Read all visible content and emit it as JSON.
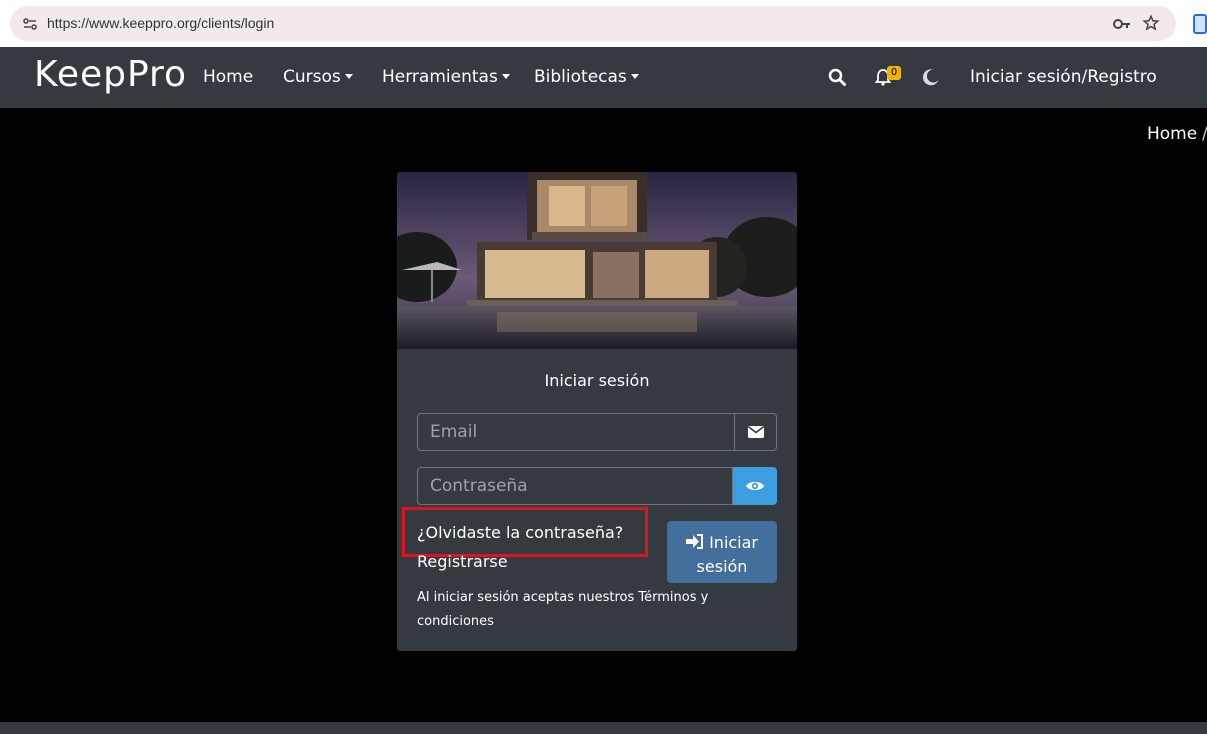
{
  "browser": {
    "url": "https://www.keeppro.org/clients/login"
  },
  "navbar": {
    "logo": "KeepPro",
    "links": [
      "Home",
      "Cursos",
      "Herramientas",
      "Bibliotecas"
    ],
    "notification_count": "0",
    "login_register": "Iniciar sesión/Registro"
  },
  "breadcrumb": {
    "home": "Home",
    "separator": "/"
  },
  "login_card": {
    "title": "Iniciar sesión",
    "email_placeholder": "Email",
    "password_placeholder": "Contraseña",
    "forgot_password": "¿Olvidaste la contraseña?",
    "register": "Registrarse",
    "login_button_line1": "Iniciar",
    "login_button_line2": "sesión",
    "terms": "Al iniciar sesión aceptas nuestros Términos y condiciones"
  },
  "colors": {
    "navbar_bg": "#343a40",
    "card_bg": "#343a40",
    "eye_button": "#3a9ee0",
    "login_button": "#446f9d",
    "highlight": "#e0141e",
    "badge": "#f0b400"
  },
  "icons": [
    "site-settings-icon",
    "key-icon",
    "star-icon",
    "search-icon",
    "bell-icon",
    "moon-icon",
    "envelope-icon",
    "eye-icon",
    "sign-in-icon"
  ]
}
